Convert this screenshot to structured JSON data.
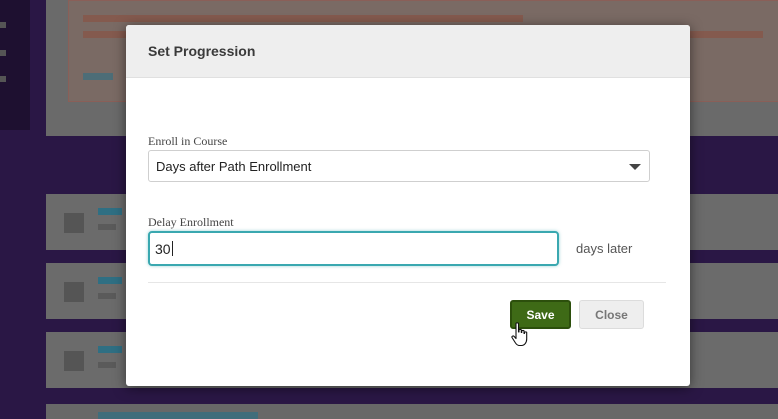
{
  "modal": {
    "title": "Set Progression",
    "enroll_label": "Enroll in Course",
    "enroll_value": "Days after Path Enrollment",
    "delay_label": "Delay Enrollment",
    "delay_value": "30",
    "delay_suffix": "days later",
    "save_label": "Save",
    "close_label": "Close"
  },
  "colors": {
    "save_button": "#3e6a16",
    "input_focus_border": "#3aa8b0",
    "page_background": "#2a1745"
  },
  "icons": [
    "chevron-down-icon",
    "hand-pointer-cursor-icon"
  ]
}
